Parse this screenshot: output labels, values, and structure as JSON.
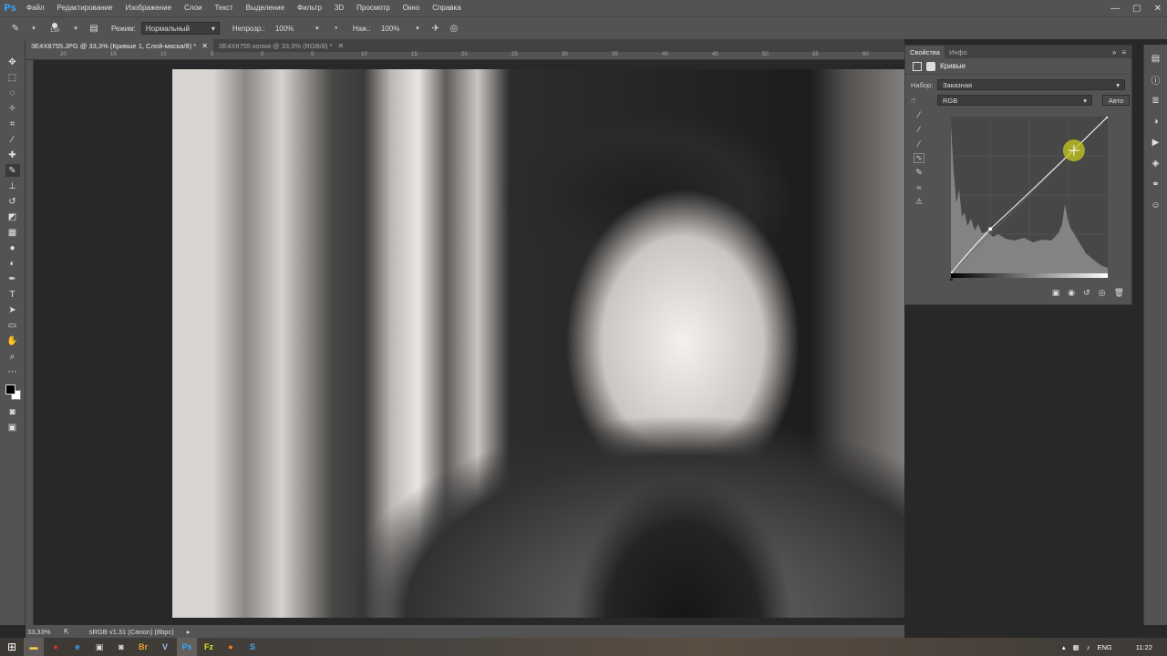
{
  "app": {
    "logo": "Ps"
  },
  "menu": [
    "Файл",
    "Редактирование",
    "Изображение",
    "Слои",
    "Текст",
    "Выделение",
    "Фильтр",
    "3D",
    "Просмотр",
    "Окно",
    "Справка"
  ],
  "window_controls": {
    "minimize": "—",
    "maximize": "▢",
    "close": "✕"
  },
  "options_bar": {
    "brush_size": "150",
    "mode_label": "Режим:",
    "mode_value": "Нормальный",
    "opacity_label": "Непрозр.:",
    "opacity_value": "100%",
    "flow_label": "Наж.:",
    "flow_value": "100%"
  },
  "tabs": [
    {
      "title": "3E4X8755.JPG @ 33,3% (Кривые 1, Слой-маска/8) *",
      "close": "✕"
    },
    {
      "title": "3E4X8755 копия @ 33,3% (RGB/8) *",
      "close": "✕"
    }
  ],
  "ruler_ticks": [
    "20",
    "15",
    "10",
    "5",
    "0",
    "5",
    "10",
    "15",
    "20",
    "25",
    "30",
    "35",
    "40",
    "45",
    "50",
    "55",
    "60"
  ],
  "status_bar": {
    "zoom": "33,33%",
    "profile": "sRGB v1.31 (Canon) (8bpc)"
  },
  "properties_panel": {
    "tabs": [
      "Свойства",
      "Инфо"
    ],
    "title": "Кривые",
    "preset_label": "Набор:",
    "preset_value": "Заказная",
    "channel_value": "RGB",
    "auto_label": "Авто",
    "curve_points": [
      {
        "input": 0,
        "output": 0
      },
      {
        "input": 64,
        "output": 72
      },
      {
        "input": 255,
        "output": 255
      }
    ],
    "control_point": {
      "input": 200,
      "output": 200
    }
  },
  "tray": {
    "language": "ENG",
    "time": "11:22"
  },
  "colors": {
    "accent": "#31a8ff",
    "panel": "#535353",
    "canvas": "#282828",
    "highlight": "#c8c81e"
  }
}
